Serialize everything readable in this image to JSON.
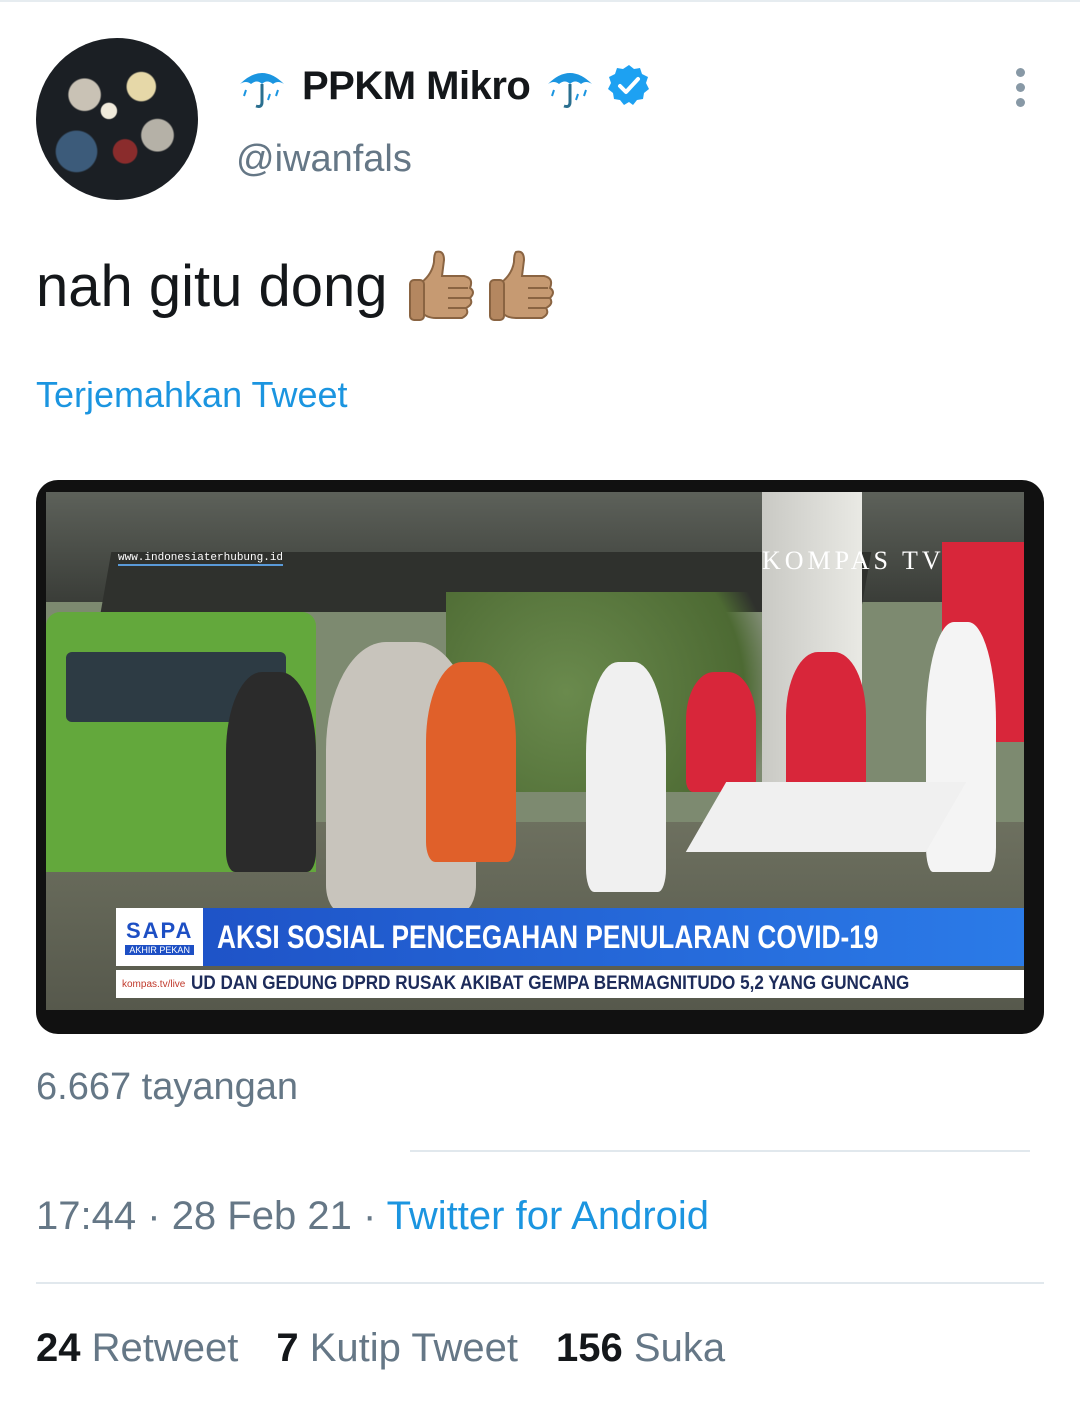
{
  "tweet": {
    "display_name": "PPKM Mikro",
    "handle": "@iwanfals",
    "text": "nah gitu dong",
    "translate_link": "Terjemahkan Tweet",
    "icons": {
      "name_prefix": "umbrella-rain-icon",
      "name_suffix": "umbrella-rain-icon",
      "verified": "verified-badge-icon",
      "more": "more-vertical-icon",
      "emoji": [
        "thumbs-up-medium-skin-icon",
        "thumbs-up-medium-skin-icon"
      ]
    }
  },
  "media": {
    "watermark_url": "www.indonesiaterhubung.id",
    "channel_logo": "KOMPAS TV",
    "program": "SAPA",
    "program_sub": "AKHIR PEKAN",
    "headline": "AKSI SOSIAL PENCEGAHAN PENULARAN COVID-19",
    "ticker_brand": "kompas.tv/live",
    "ticker_text": "UD DAN GEDUNG DPRD RUSAK AKIBAT GEMPA BERMAGNITUDO 5,2 YANG GUNCANG"
  },
  "views": "6.667 tayangan",
  "meta": {
    "time": "17:44",
    "date": "28 Feb 21",
    "separator": "·",
    "source": "Twitter for Android"
  },
  "stats": {
    "retweets_count": "24",
    "retweets_label": "Retweet",
    "quotes_count": "7",
    "quotes_label": "Kutip Tweet",
    "likes_count": "156",
    "likes_label": "Suka"
  },
  "colors": {
    "link": "#1b95e0",
    "secondary_text": "#657786",
    "verified": "#1da1f2",
    "umbrella": "#1b95e0"
  }
}
